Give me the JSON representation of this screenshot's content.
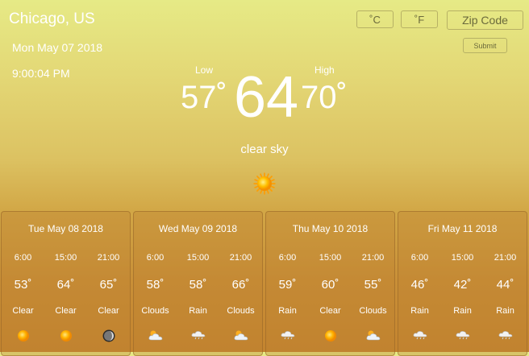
{
  "location": {
    "city": "Chicago, US"
  },
  "datetime": {
    "date": "Mon May 07 2018",
    "time": "9:00:04 PM"
  },
  "controls": {
    "celsius": "˚C",
    "fahrenheit": "˚F",
    "zip_placeholder": "Zip Code",
    "submit": "Submit"
  },
  "current": {
    "low_label": "Low",
    "low": "57˚",
    "temp": "64",
    "high_label": "High",
    "high": "70˚",
    "condition": "clear sky",
    "icon": "sun-icon"
  },
  "forecast": [
    {
      "date": "Tue May 08 2018",
      "slots": [
        {
          "time": "6:00",
          "temp": "53˚",
          "desc": "Clear",
          "icon": "sun-icon"
        },
        {
          "time": "15:00",
          "temp": "64˚",
          "desc": "Clear",
          "icon": "sun-icon"
        },
        {
          "time": "21:00",
          "temp": "65˚",
          "desc": "Clear",
          "icon": "moon-icon"
        }
      ]
    },
    {
      "date": "Wed May 09 2018",
      "slots": [
        {
          "time": "6:00",
          "temp": "58˚",
          "desc": "Clouds",
          "icon": "cloud-sun-icon"
        },
        {
          "time": "15:00",
          "temp": "58˚",
          "desc": "Rain",
          "icon": "rain-cloud-icon"
        },
        {
          "time": "21:00",
          "temp": "66˚",
          "desc": "Clouds",
          "icon": "cloud-sun-icon"
        }
      ]
    },
    {
      "date": "Thu May 10 2018",
      "slots": [
        {
          "time": "6:00",
          "temp": "59˚",
          "desc": "Rain",
          "icon": "rain-cloud-icon"
        },
        {
          "time": "15:00",
          "temp": "60˚",
          "desc": "Clear",
          "icon": "sun-icon"
        },
        {
          "time": "21:00",
          "temp": "55˚",
          "desc": "Clouds",
          "icon": "cloud-sun-icon"
        }
      ]
    },
    {
      "date": "Fri May 11 2018",
      "slots": [
        {
          "time": "6:00",
          "temp": "46˚",
          "desc": "Rain",
          "icon": "rain-cloud-icon"
        },
        {
          "time": "15:00",
          "temp": "42˚",
          "desc": "Rain",
          "icon": "rain-cloud-icon"
        },
        {
          "time": "21:00",
          "temp": "44˚",
          "desc": "Rain",
          "icon": "rain-cloud-icon"
        }
      ]
    }
  ]
}
